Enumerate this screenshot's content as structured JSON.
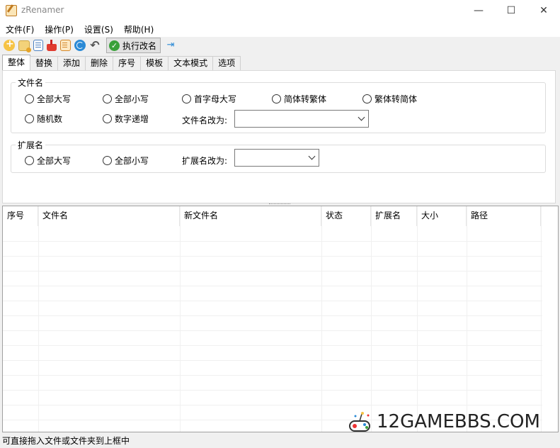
{
  "window": {
    "title": "zRenamer",
    "min": "—",
    "max": "☐",
    "close": "✕"
  },
  "menu": [
    "文件(F)",
    "操作(P)",
    "设置(S)",
    "帮助(H)"
  ],
  "toolbar": {
    "icons": [
      "add-file-icon",
      "add-folder-icon",
      "copy-icon",
      "clear-icon",
      "edit-list-icon",
      "refresh-icon",
      "undo-icon"
    ],
    "execute_label": "执行改名",
    "pin_icon": "pin-icon"
  },
  "tabs": [
    "整体",
    "替换",
    "添加",
    "删除",
    "序号",
    "模板",
    "文本模式",
    "选项"
  ],
  "filename_group": {
    "legend": "文件名",
    "options": [
      "全部大写",
      "全部小写",
      "首字母大写",
      "简体转繁体",
      "繁体转简体",
      "随机数",
      "数字递增"
    ],
    "rename_to_label": "文件名改为:",
    "rename_to_value": ""
  },
  "ext_group": {
    "legend": "扩展名",
    "options": [
      "全部大写",
      "全部小写"
    ],
    "rename_to_label": "扩展名改为:",
    "rename_to_value": ""
  },
  "list": {
    "columns": [
      "序号",
      "文件名",
      "新文件名",
      "状态",
      "扩展名",
      "大小",
      "路径"
    ]
  },
  "status": {
    "text": "可直接拖入文件或文件夹到上框中"
  },
  "watermark": {
    "text": "12GAMEBBS.COM"
  }
}
